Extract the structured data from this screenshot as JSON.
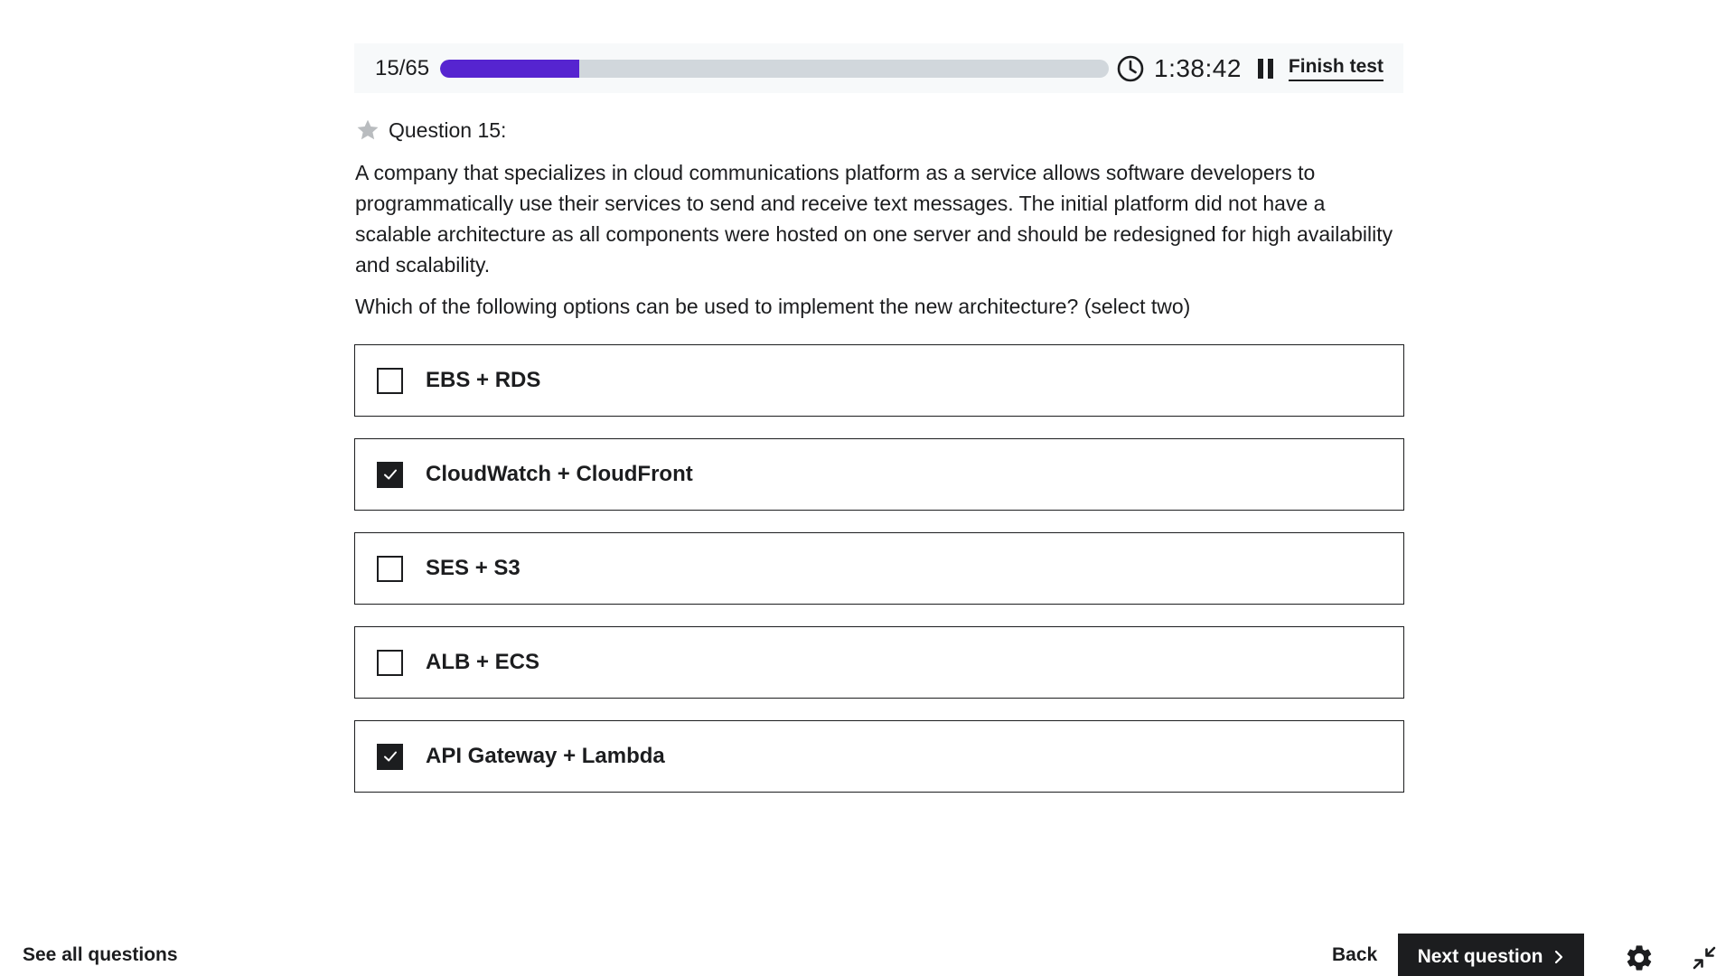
{
  "topbar": {
    "counter": "15/65",
    "progress_fraction": 0.2079,
    "timer": "1:38:42",
    "finish_label": "Finish test"
  },
  "question": {
    "label": "Question 15:",
    "text": "A company that specializes in cloud communications platform as a service allows software developers to programmatically use their services to send and receive text messages. The initial platform did not have a scalable architecture as all components were hosted on one server and should be redesigned for high availability and scalability.",
    "prompt": "Which of the following options can be used to implement the new architecture? (select two)"
  },
  "options": [
    {
      "label": "EBS + RDS",
      "checked": false
    },
    {
      "label": "CloudWatch + CloudFront",
      "checked": true
    },
    {
      "label": "SES + S3",
      "checked": false
    },
    {
      "label": "ALB + ECS",
      "checked": false
    },
    {
      "label": "API Gateway + Lambda",
      "checked": true
    }
  ],
  "footer": {
    "see_all_label": "See all questions",
    "back_label": "Back",
    "next_label": "Next question"
  },
  "icons": {
    "star": "star-icon",
    "clock": "clock-icon",
    "pause": "pause-icon",
    "check": "check-icon",
    "chevron": "chevron-right-icon",
    "gear": "gear-icon",
    "exit_fullscreen": "exit-fullscreen-icon"
  },
  "colors": {
    "accent": "#5624d0",
    "track": "#d1d7dc",
    "text": "#1c1d1f",
    "topbar_bg": "#f7f9fa",
    "star": "#b9bcbf"
  }
}
